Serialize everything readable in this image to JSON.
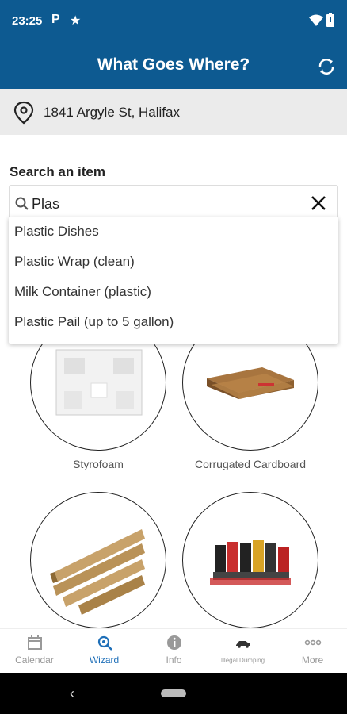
{
  "status": {
    "time": "23:25",
    "p_icon": "P"
  },
  "app": {
    "title": "What Goes Where?"
  },
  "address": {
    "text": "1841 Argyle St, Halifax"
  },
  "search": {
    "label": "Search an item",
    "value": "Plas",
    "suggestions": [
      "Plastic Dishes",
      "Plastic Wrap (clean)",
      "Milk Container (plastic)",
      "Plastic Pail (up to 5 gallon)"
    ]
  },
  "items": [
    {
      "label": "Styrofoam"
    },
    {
      "label": "Corrugated Cardboard"
    },
    {
      "label": ""
    },
    {
      "label": ""
    }
  ],
  "nav": {
    "calendar": "Calendar",
    "wizard": "Wizard",
    "info": "Info",
    "illegal_dumping": "Illegal Dumping",
    "more": "More"
  },
  "colors": {
    "primary": "#0d5a91",
    "active_nav": "#1e6fb8"
  }
}
